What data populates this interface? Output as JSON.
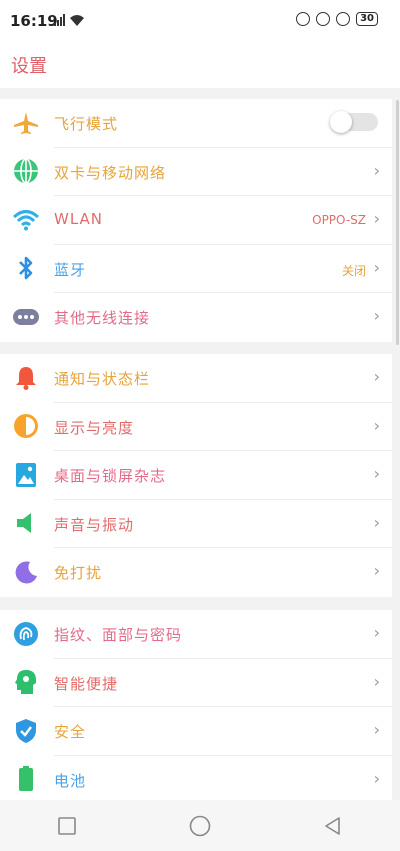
{
  "status": {
    "time": "16:19",
    "battery": "30"
  },
  "title": "设置",
  "groups": [
    {
      "items": [
        {
          "label": "飞行模式",
          "color": "#e8a33a",
          "icon": "airplane-icon",
          "toggle": "off"
        },
        {
          "label": "双卡与移动网络",
          "color": "#e8a33a",
          "icon": "globe-icon"
        },
        {
          "label": "WLAN",
          "color": "#e36b6b",
          "value": "OPPO-SZ",
          "icon": "wifi-icon"
        },
        {
          "label": "蓝牙",
          "color": "#4aa3e8",
          "value": "关闭",
          "icon": "bluetooth-icon"
        },
        {
          "label": "其他无线连接",
          "color": "#e36b8a",
          "icon": "more-dots-icon"
        }
      ]
    },
    {
      "items": [
        {
          "label": "通知与状态栏",
          "color": "#e8a33a",
          "icon": "bell-icon"
        },
        {
          "label": "显示与亮度",
          "color": "#e36b6b",
          "icon": "brightness-icon"
        },
        {
          "label": "桌面与锁屏杂志",
          "color": "#e36b8a",
          "icon": "picture-icon"
        },
        {
          "label": "声音与振动",
          "color": "#e36b6b",
          "icon": "speaker-icon"
        },
        {
          "label": "免打扰",
          "color": "#e8a33a",
          "icon": "moon-icon"
        }
      ]
    },
    {
      "items": [
        {
          "label": "指纹、面部与密码",
          "color": "#e36b8a",
          "icon": "fingerprint-icon"
        },
        {
          "label": "智能便捷",
          "color": "#e36b6b",
          "icon": "smart-head-icon"
        },
        {
          "label": "安全",
          "color": "#e8a33a",
          "icon": "shield-icon"
        },
        {
          "label": "电池",
          "color": "#4aa3e8",
          "icon": "battery-icon"
        }
      ]
    }
  ],
  "colors": {
    "title": "#e0606b",
    "value_orange": "#e8a33a"
  }
}
